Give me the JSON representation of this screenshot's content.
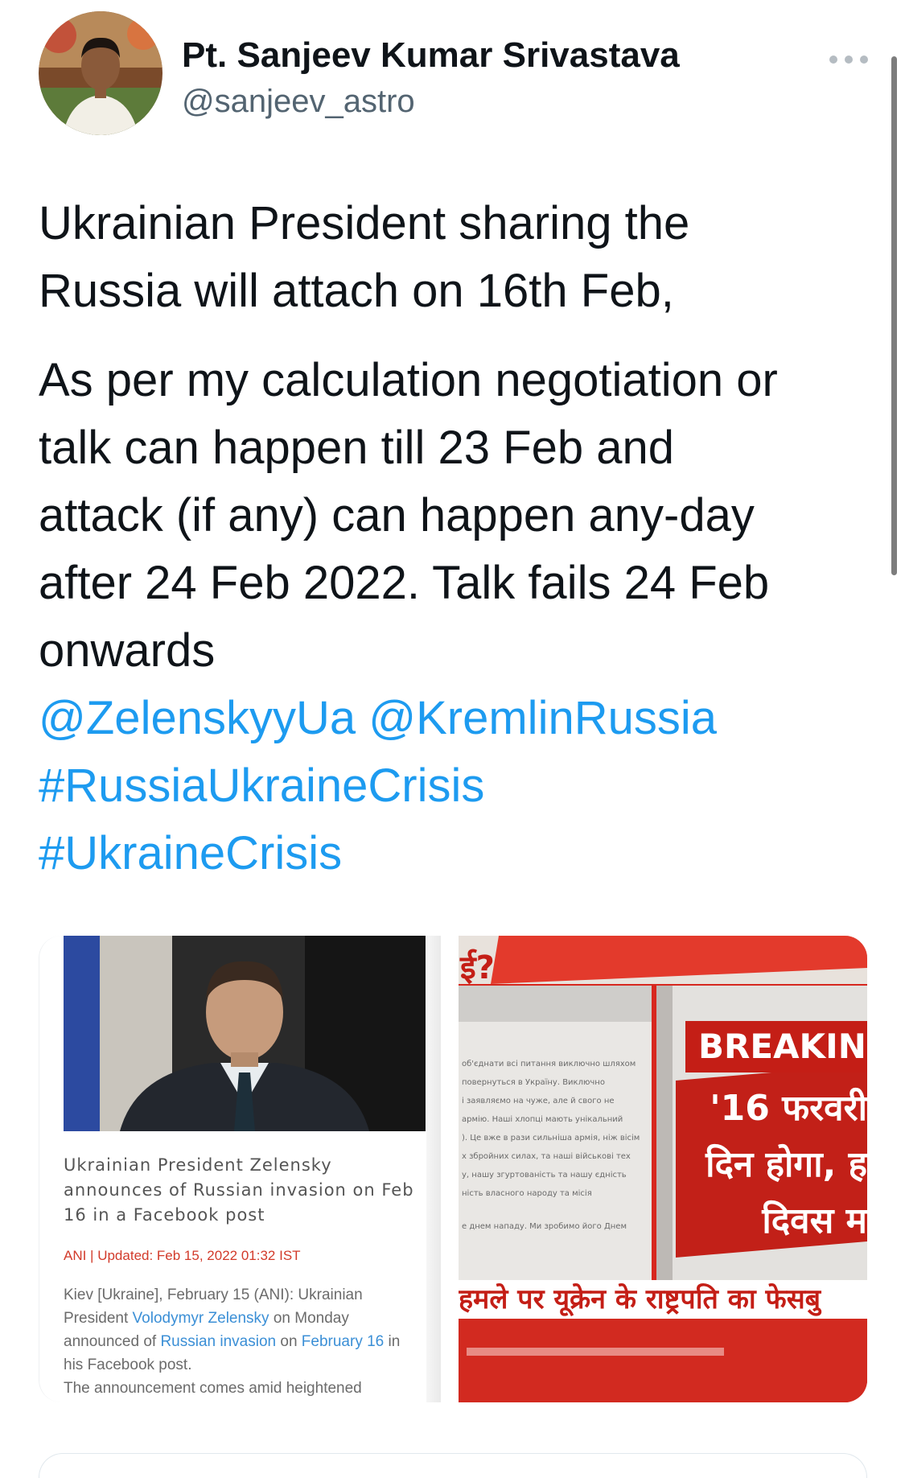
{
  "author": {
    "name": "Pt. Sanjeev Kumar Srivastava",
    "handle": "@sanjeev_astro"
  },
  "tweet": {
    "line1": "Ukrainian President sharing the",
    "line2": "Russia will attach on 16th Feb,",
    "para2": [
      "As per my calculation negotiation or",
      "talk can happen till 23 Feb and",
      "attack (if any) can happen any-day",
      "after 24 Feb 2022. Talk fails 24 Feb",
      "onwards"
    ],
    "mention1": "@ZelenskyyUa",
    "mention2": "@KremlinRussia",
    "hashtag1": "#RussiaUkraineCrisis",
    "hashtag2": "#UkraineCrisis"
  },
  "media_left": {
    "caption": "Ukrainian President Zelensky announces of Russian invasion on Feb 16 in a Facebook post",
    "meta": "ANI | Updated: Feb 15, 2022 01:32 IST",
    "body_a": "Kiev [Ukraine], February 15 (ANI): Ukrainian President ",
    "body_link1": "Volodymyr Zelensky",
    "body_b": " on Monday announced of ",
    "body_link2": "Russian invasion",
    "body_c": " on ",
    "body_link3": "February 16",
    "body_d": " in his Facebook post.",
    "body_e": "The announcement comes amid heightened"
  },
  "media_right": {
    "top_mark": "ई?",
    "breaking": "BREAKING",
    "hindi_lines": [
      "'16 फरवरी",
      "दिन होगा, ह",
      "दिवस म"
    ],
    "ticker": "हमले पर यूक्रेन के राष्ट्रपति का फेसबु",
    "post_lines": [
      "об'єднати всі питання виключно шляхом",
      "повернуться в Україну. Виключно",
      "і заявляємо на чуже, але й свого не",
      "армію. Наші хлопці мають унікальний",
      "). Це вже в рази сильніша армія, ніж вісім",
      "х збройних силах, та наші військові тех",
      "у, нашу згуртованість та нашу єдність",
      "ність власного народу та місія",
      "е днем нападу. Ми зробимо його Днем"
    ]
  },
  "colors": {
    "link": "#1d9bf0",
    "text": "#0f1419",
    "secondary": "#536471",
    "news_red": "#d7271e"
  },
  "icons": {
    "more": "more-horizontal-icon"
  }
}
